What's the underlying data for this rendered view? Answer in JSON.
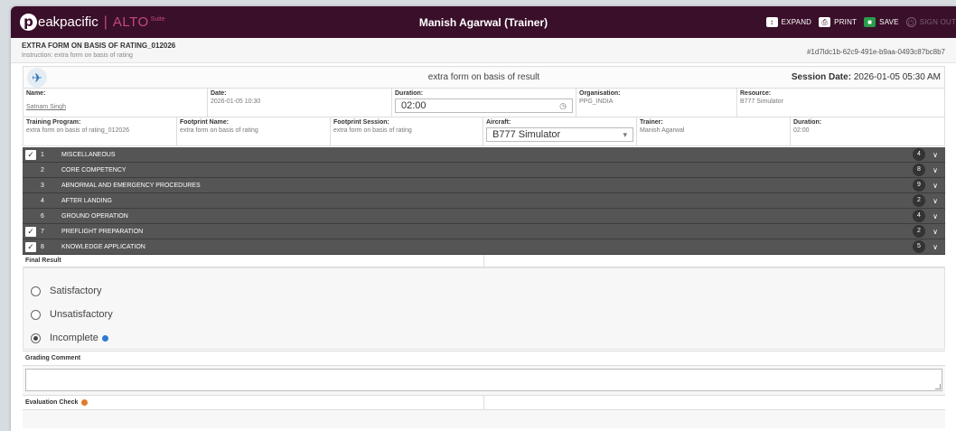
{
  "brand": {
    "name": "eakpacific",
    "logo_letter": "p",
    "alto": "ALTO",
    "suite": "Suite"
  },
  "header": {
    "user_title": "Manish Agarwal (Trainer)",
    "expand_label": "EXPAND",
    "print_label": "PRINT",
    "save_label": "SAVE",
    "signout_label": "SIGN OUT"
  },
  "form": {
    "title": "EXTRA FORM ON BASIS OF RATING_012026",
    "instruction": "Instruction: extra form on basis of rating",
    "id": "#1d7ldc1b-62c9-491e-b9aa-0493c87bc8b7",
    "name": "extra form on basis of result",
    "session_label": "Session Date:",
    "session_value": "2026-01-05 05:30 AM"
  },
  "row1": {
    "name_label": "Name:",
    "name_value": "Satnam Singh",
    "date_label": "Date:",
    "date_value": "2026-01-05 10:30",
    "duration_label": "Duration:",
    "duration_value": "02:00",
    "org_label": "Organisation:",
    "org_value": "PPG_INDIA",
    "resource_label": "Resource:",
    "resource_value": "B777 Simulator"
  },
  "row2": {
    "program_label": "Training Program:",
    "program_value": "extra form on basis of rating_012026",
    "footprint_label": "Footprint Name:",
    "footprint_value": "extra form on basis of rating",
    "fsession_label": "Footprint Session:",
    "fsession_value": "extra form on basis of rating",
    "aircraft_label": "Aircraft:",
    "aircraft_value": "B777 Simulator",
    "trainer_label": "Trainer:",
    "trainer_value": "Manish Agarwal",
    "duration_label": "Duration:",
    "duration_value": "02:00"
  },
  "sections": [
    {
      "num": "1",
      "title": "MISCELLANEOUS",
      "count": "4",
      "checked": true
    },
    {
      "num": "2",
      "title": "CORE COMPETENCY",
      "count": "8",
      "checked": false
    },
    {
      "num": "3",
      "title": "ABNORMAL AND EMERGENCY PROCEDURES",
      "count": "9",
      "checked": false
    },
    {
      "num": "4",
      "title": "AFTER LANDING",
      "count": "2",
      "checked": false
    },
    {
      "num": "6",
      "title": "GROUND OPERATION",
      "count": "4",
      "checked": false
    },
    {
      "num": "7",
      "title": "PREFLIGHT PREPARATION",
      "count": "2",
      "checked": true
    },
    {
      "num": "8",
      "title": "KNOWLEDGE APPLICATION",
      "count": "5",
      "checked": true
    }
  ],
  "final_result": {
    "label": "Final Result",
    "options": [
      "Satisfactory",
      "Unsatisfactory",
      "Incomplete"
    ],
    "selected": "Incomplete"
  },
  "grading_comment": {
    "label": "Grading Comment",
    "value": ""
  },
  "evaluation_check": {
    "label": "Evaluation Check"
  },
  "colors": {
    "topbar": "#3a0f2a",
    "accent_pink": "#c24a7a",
    "save_green": "#2b9c4a",
    "section_bg": "#555555",
    "incomplete_dot": "#2f78d4",
    "eval_dot": "#e07a2a"
  }
}
